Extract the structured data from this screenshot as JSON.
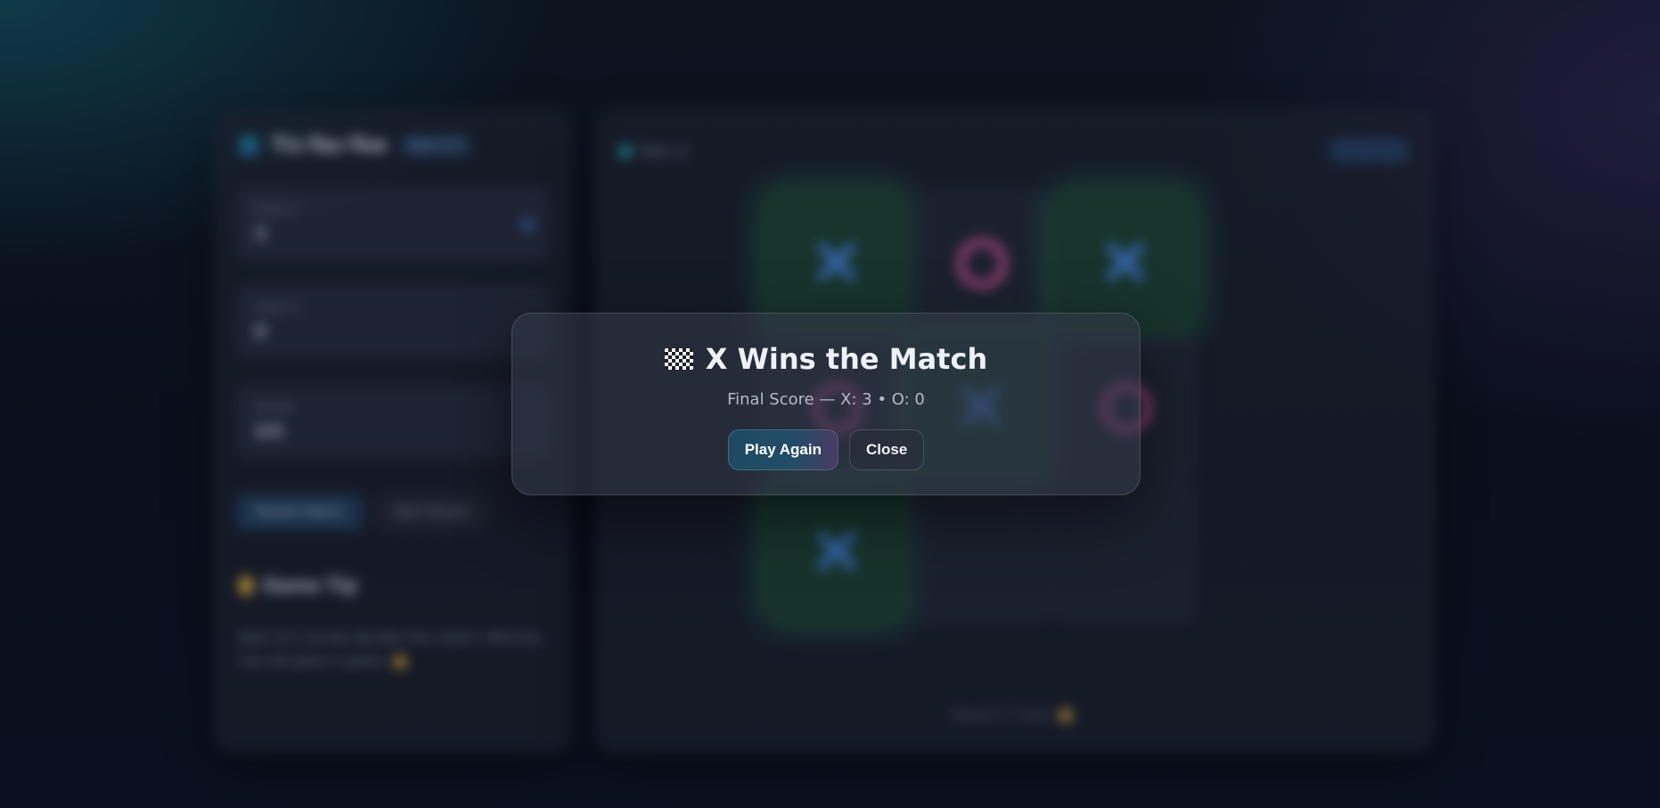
{
  "background_app": {
    "brand": {
      "title": "Tic-Tac-Toe",
      "badge": "Best of 5"
    },
    "fields": [
      {
        "label": "Player X",
        "value": "3"
      },
      {
        "label": "Player O",
        "value": "0"
      },
      {
        "label": "Rounds",
        "value": "3/5"
      }
    ],
    "buttons": {
      "restart": "Restart Match",
      "next": "Next Round"
    },
    "tip": {
      "title": "Game Tip",
      "text": "Best of 5 rounds decides the match. Winning line will glow in green."
    },
    "turn_label": "Turn: X",
    "board": [
      [
        "X",
        "O",
        "X"
      ],
      [
        "O",
        "X",
        "O"
      ],
      [
        "X",
        "",
        ""
      ]
    ],
    "winning_cells": [
      [
        0,
        2
      ],
      [
        1,
        1
      ],
      [
        2,
        0
      ]
    ],
    "board_footer": "Round 3: X wins"
  },
  "modal": {
    "icon": "checkered-flag-icon",
    "title": "X Wins the Match",
    "subtitle": "Final Score — X: 3 • O: 0",
    "primary_button": "Play Again",
    "secondary_button": "Close"
  },
  "colors": {
    "x_mark": "#3f78c9",
    "o_mark": "#c7508d",
    "win_glow": "#28a05a",
    "accent_teal": "#2aa6b7"
  }
}
